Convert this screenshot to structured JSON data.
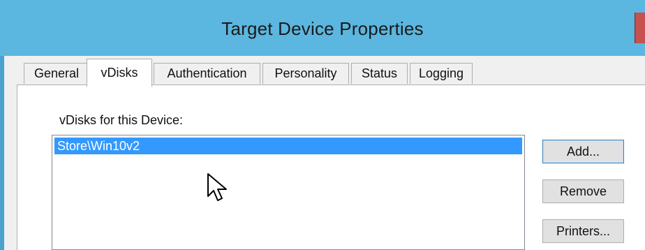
{
  "window": {
    "title": "Target Device Properties"
  },
  "tabs": [
    {
      "label": "General"
    },
    {
      "label": "vDisks",
      "active": true
    },
    {
      "label": "Authentication"
    },
    {
      "label": "Personality"
    },
    {
      "label": "Status"
    },
    {
      "label": "Logging"
    }
  ],
  "vdisks": {
    "label": "vDisks for this Device:",
    "items": [
      {
        "value": "Store\\Win10v2",
        "selected": true
      }
    ]
  },
  "buttons": {
    "add": "Add...",
    "remove": "Remove",
    "printers": "Printers..."
  },
  "colors": {
    "titlebar": "#5bb6e0",
    "selection": "#3399ff"
  }
}
